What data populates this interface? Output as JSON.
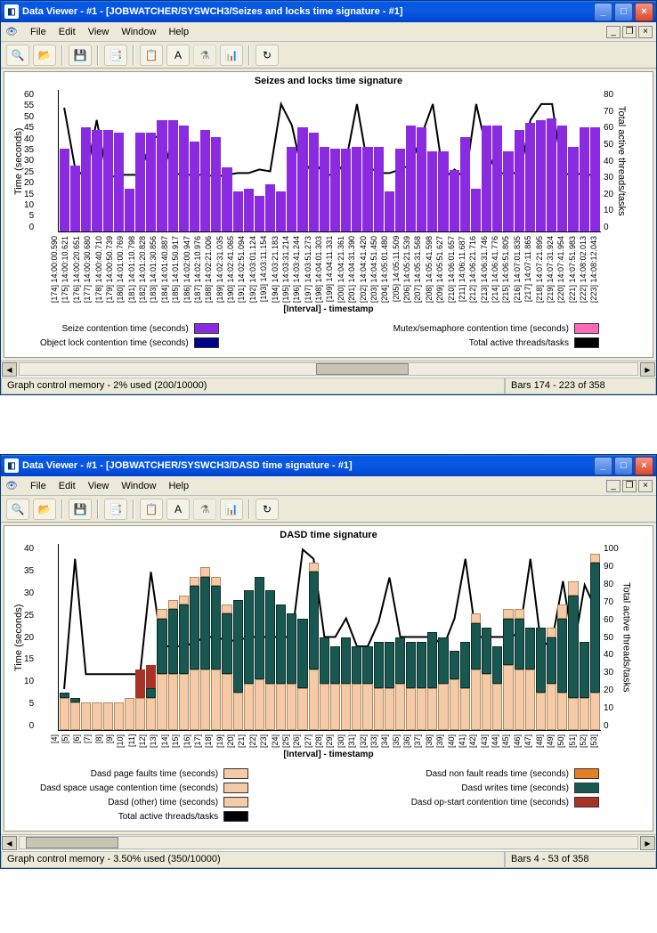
{
  "windows": [
    {
      "title": "Data Viewer - #1 - [JOBWATCHER/SYSWCH3/Seizes and locks time signature - #1]",
      "menu": [
        "File",
        "Edit",
        "View",
        "Window",
        "Help"
      ],
      "chart": {
        "title": "Seizes and locks time signature",
        "ylabel_left": "Time (seconds)",
        "ylabel_right": "Total active threads/tasks",
        "xlabel": "[Interval] - timestamp"
      },
      "legend_left": [
        {
          "label": "Seize contention time (seconds)",
          "color": "#8A2BE2"
        },
        {
          "label": "Object lock contention time (seconds)",
          "color": "#00008B"
        }
      ],
      "legend_right": [
        {
          "label": "Mutex/semaphore contention time (seconds)",
          "color": "#FF69B4"
        },
        {
          "label": "Total active threads/tasks",
          "color": "#000000"
        }
      ],
      "status_left": "Graph control memory - 2% used (200/10000)",
      "status_right": "Bars 174 - 223 of 358"
    },
    {
      "title": "Data Viewer - #1 - [JOBWATCHER/SYSWCH3/DASD time signature - #1]",
      "menu": [
        "File",
        "Edit",
        "View",
        "Window",
        "Help"
      ],
      "chart": {
        "title": "DASD time signature",
        "ylabel_left": "Time (seconds)",
        "ylabel_right": "Total active threads/tasks",
        "xlabel": "[Interval] - timestamp"
      },
      "legend_left": [
        {
          "label": "Dasd page faults time (seconds)",
          "color": "#F5CBA7"
        },
        {
          "label": "Dasd space usage contention time (seconds)",
          "color": "#F5CBA7"
        },
        {
          "label": "Dasd (other) time (seconds)",
          "color": "#F5CBA7"
        },
        {
          "label": "Total active threads/tasks",
          "color": "#000000"
        }
      ],
      "legend_right": [
        {
          "label": "Dasd non fault reads time (seconds)",
          "color": "#E67E22"
        },
        {
          "label": "Dasd writes time (seconds)",
          "color": "#195751"
        },
        {
          "label": "Dasd op-start contention time (seconds)",
          "color": "#A93226"
        }
      ],
      "status_left": "Graph control memory - 3.50% used (350/10000)",
      "status_right": "Bars 4 - 53 of 358"
    }
  ],
  "chart_data": [
    {
      "type": "bar",
      "title": "Seizes and locks time signature",
      "xlabel": "[Interval] - timestamp",
      "ylabel": "Time (seconds)",
      "ylim_left": [
        0,
        60
      ],
      "yticks_left": [
        0,
        5,
        10,
        15,
        20,
        25,
        30,
        35,
        40,
        45,
        50,
        55,
        60
      ],
      "ylim_right": [
        0,
        80
      ],
      "yticks_right": [
        0,
        10,
        20,
        30,
        40,
        50,
        60,
        70,
        80
      ],
      "categories": [
        "[174] 14:00:00.590",
        "[175] 14:00:10.621",
        "[176] 14:00:20.651",
        "[177] 14:00:30.680",
        "[178] 14:00:40.710",
        "[179] 14:00:50.739",
        "[180] 14:01:00.769",
        "[181] 14:01:10.798",
        "[182] 14:01:20.828",
        "[183] 14:01:30.856",
        "[184] 14:01:40.887",
        "[185] 14:01:50.917",
        "[186] 14:02:00.947",
        "[187] 14:02:10.976",
        "[188] 14:02:21.006",
        "[189] 14:02:31.035",
        "[190] 14:02:41.065",
        "[191] 14:02:51.094",
        "[192] 14:03:01.124",
        "[193] 14:03:11.154",
        "[194] 14:03:21.183",
        "[195] 14:03:31.214",
        "[196] 14:03:41.244",
        "[197] 14:03:51.273",
        "[198] 14:04:01.303",
        "[199] 14:04:11.331",
        "[200] 14:04:21.361",
        "[201] 14:04:31.390",
        "[202] 14:04:41.420",
        "[203] 14:04:51.450",
        "[204] 14:05:01.480",
        "[205] 14:05:11.509",
        "[206] 14:05:21.539",
        "[207] 14:05:31.568",
        "[208] 14:05:41.598",
        "[209] 14:05:51.627",
        "[210] 14:06:01.657",
        "[211] 14:06:11.687",
        "[212] 14:06:21.716",
        "[213] 14:06:31.746",
        "[214] 14:06:41.776",
        "[215] 14:06:51.805",
        "[216] 14:07:01.835",
        "[217] 14:07:11.865",
        "[218] 14:07:21.895",
        "[219] 14:07:31.924",
        "[220] 14:07:41.954",
        "[221] 14:07:51.983",
        "[222] 14:08:02.013",
        "[223] 14:08:12.043"
      ],
      "series": [
        {
          "name": "Seize contention time (seconds)",
          "color": "#8A2BE2",
          "values": [
            35,
            28,
            44,
            43,
            43,
            42,
            18,
            42,
            42,
            47,
            47,
            45,
            38,
            43,
            40,
            27,
            17,
            18,
            15,
            20,
            17,
            36,
            44,
            42,
            36,
            35,
            35,
            36,
            36,
            36,
            17,
            35,
            45,
            44,
            34,
            34,
            26,
            40,
            18,
            45,
            45,
            34,
            43,
            46,
            47,
            48,
            45,
            36,
            44,
            44
          ]
        },
        {
          "name": "Object lock contention time (seconds)",
          "color": "#00008B",
          "values": [
            0,
            0,
            0,
            0,
            0,
            0,
            0,
            0,
            0,
            0,
            0,
            0,
            0,
            0,
            0,
            0,
            0,
            0,
            0,
            0,
            0,
            0,
            0,
            0,
            0,
            0,
            0,
            0,
            0,
            0,
            0,
            0,
            0,
            0,
            0,
            0,
            0,
            0,
            0,
            0,
            0,
            0,
            0,
            0,
            0,
            0,
            0,
            0,
            0,
            0
          ]
        },
        {
          "name": "Mutex/semaphore contention time (seconds)",
          "color": "#FF69B4",
          "values": [
            0,
            0,
            0,
            0,
            0,
            0,
            0,
            0,
            0,
            0,
            0,
            0,
            0,
            0,
            0,
            0,
            0,
            0,
            0,
            0,
            0,
            0,
            0,
            0,
            0,
            0,
            0,
            0,
            0,
            0,
            0,
            0,
            0,
            0,
            0,
            0,
            0,
            0,
            0,
            0,
            0,
            0,
            0,
            0,
            0,
            0,
            0,
            0,
            0,
            0
          ]
        }
      ],
      "line_series": {
        "name": "Total active threads/tasks",
        "axis": "right",
        "values": [
          70,
          36,
          30,
          63,
          30,
          32,
          32,
          32,
          52,
          55,
          33,
          32,
          32,
          32,
          31,
          32,
          33,
          33,
          35,
          34,
          72,
          60,
          32,
          40,
          32,
          32,
          40,
          72,
          37,
          33,
          33,
          35,
          38,
          55,
          72,
          30,
          35,
          30,
          72,
          45,
          32,
          34,
          32,
          63,
          72,
          72,
          32,
          33,
          32,
          32
        ]
      }
    },
    {
      "type": "bar",
      "title": "DASD time signature",
      "xlabel": "[Interval] - timestamp",
      "ylabel": "Time (seconds)",
      "ylim_left": [
        0,
        40
      ],
      "yticks_left": [
        0,
        5,
        10,
        15,
        20,
        25,
        30,
        35,
        40
      ],
      "ylim_right": [
        0,
        100
      ],
      "yticks_right": [
        0,
        10,
        20,
        30,
        40,
        50,
        60,
        70,
        80,
        90,
        100
      ],
      "categories": [
        "[4]",
        "[5]",
        "[6]",
        "[7]",
        "[8]",
        "[9]",
        "[10]",
        "[11]",
        "[12]",
        "[13]",
        "[14]",
        "[15]",
        "[16]",
        "[17]",
        "[18]",
        "[19]",
        "[20]",
        "[21]",
        "[22]",
        "[23]",
        "[24]",
        "[25]",
        "[26]",
        "[27]",
        "[28]",
        "[29]",
        "[30]",
        "[31]",
        "[32]",
        "[33]",
        "[34]",
        "[35]",
        "[36]",
        "[37]",
        "[38]",
        "[39]",
        "[40]",
        "[41]",
        "[42]",
        "[43]",
        "[44]",
        "[45]",
        "[46]",
        "[47]",
        "[48]",
        "[49]",
        "[50]",
        "[51]",
        "[52]",
        "[53]"
      ],
      "series": [
        {
          "name": "Dasd page faults time (seconds)",
          "color": "#F5CBA7",
          "values": [
            7,
            6,
            6,
            6,
            6,
            6,
            7,
            7,
            7,
            12,
            12,
            12,
            13,
            13,
            13,
            12,
            8,
            10,
            11,
            10,
            10,
            10,
            9,
            13,
            10,
            10,
            10,
            10,
            10,
            9,
            9,
            10,
            9,
            9,
            9,
            10,
            11,
            9,
            13,
            12,
            10,
            14,
            13,
            13,
            8,
            10,
            8,
            7,
            7,
            8
          ]
        },
        {
          "name": "Dasd writes time (seconds)",
          "color": "#195751",
          "values": [
            1,
            1,
            0,
            0,
            0,
            0,
            0,
            0,
            2,
            12,
            14,
            15,
            18,
            20,
            18,
            13,
            20,
            20,
            22,
            20,
            17,
            15,
            15,
            21,
            10,
            8,
            10,
            8,
            8,
            10,
            10,
            10,
            10,
            10,
            12,
            10,
            6,
            10,
            10,
            10,
            8,
            10,
            11,
            9,
            14,
            10,
            16,
            22,
            12,
            28
          ]
        },
        {
          "name": "Dasd (other) time (seconds)",
          "color": "#F5CBA7",
          "values": [
            0,
            0,
            0,
            0,
            0,
            0,
            0,
            0,
            0,
            2,
            2,
            2,
            2,
            2,
            2,
            2,
            0,
            0,
            0,
            0,
            0,
            0,
            0,
            2,
            0,
            0,
            0,
            0,
            0,
            0,
            0,
            0,
            0,
            0,
            0,
            0,
            0,
            0,
            2,
            0,
            0,
            2,
            2,
            0,
            0,
            2,
            3,
            3,
            0,
            2
          ]
        },
        {
          "name": "Dasd op-start contention time (seconds)",
          "color": "#A93226",
          "values": [
            0,
            0,
            0,
            0,
            0,
            0,
            0,
            6,
            5,
            0,
            0,
            0,
            0,
            0,
            0,
            0,
            0,
            0,
            0,
            0,
            0,
            0,
            0,
            0,
            0,
            0,
            0,
            0,
            0,
            0,
            0,
            0,
            0,
            0,
            0,
            0,
            0,
            0,
            0,
            0,
            0,
            0,
            0,
            0,
            0,
            0,
            0,
            0,
            0,
            0
          ]
        }
      ],
      "line_series": {
        "name": "Total active threads/tasks",
        "axis": "right",
        "values": [
          22,
          92,
          30,
          30,
          30,
          30,
          30,
          30,
          85,
          45,
          45,
          45,
          47,
          50,
          50,
          48,
          48,
          50,
          50,
          50,
          50,
          50,
          97,
          92,
          50,
          50,
          60,
          45,
          45,
          58,
          82,
          50,
          50,
          50,
          50,
          45,
          60,
          92,
          50,
          50,
          50,
          50,
          52,
          92,
          45,
          48,
          80,
          44,
          78,
          65
        ]
      }
    }
  ]
}
